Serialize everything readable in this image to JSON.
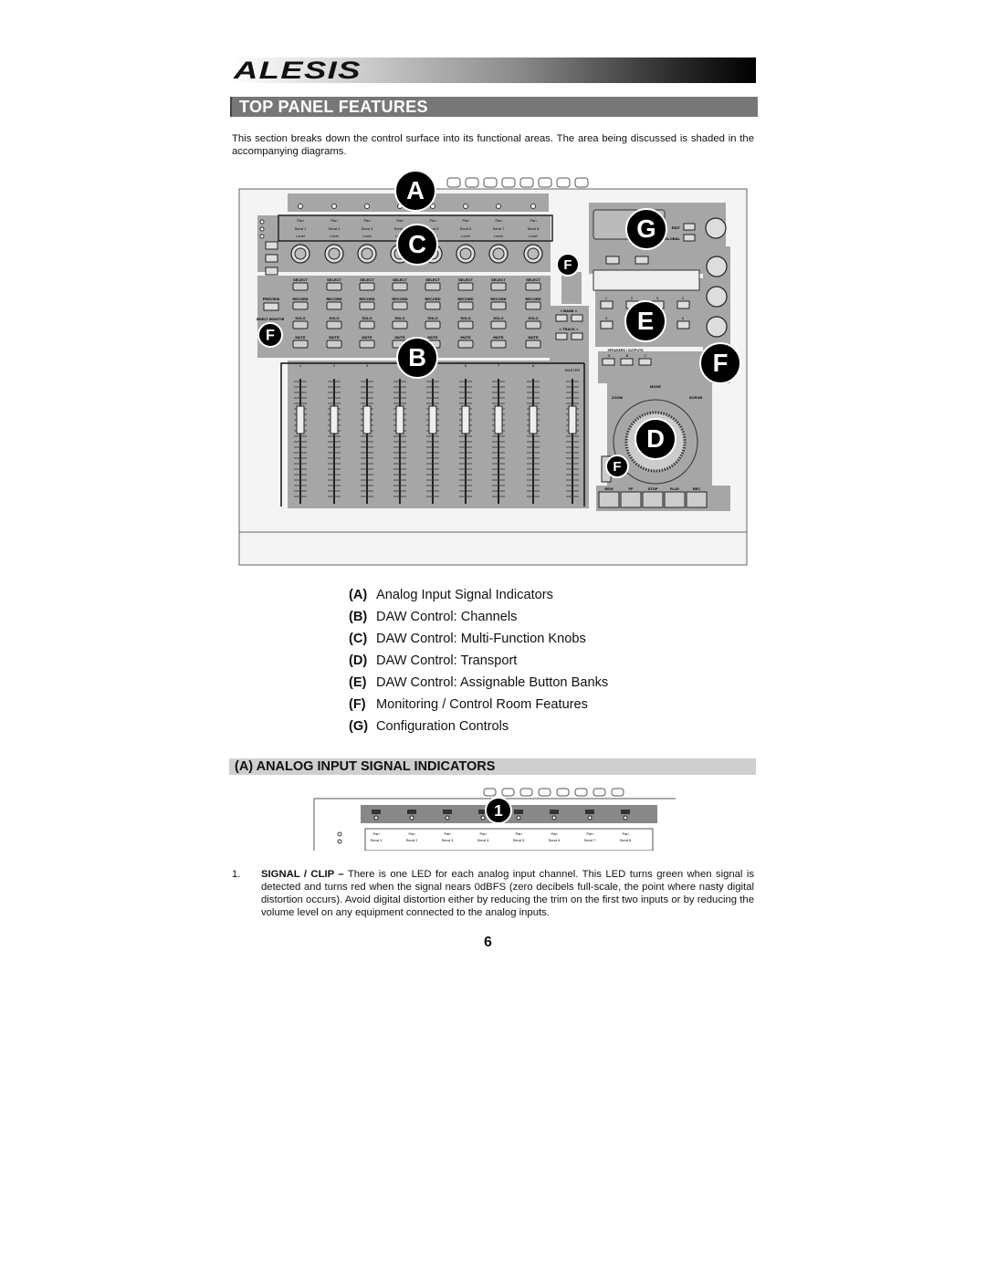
{
  "header": {
    "brand": "ALESIS",
    "title": "TOP PANEL FEATURES"
  },
  "intro": "This section breaks down the control surface into its functional areas.  The area being discussed is shaded in the accompanying diagrams.",
  "diagram": {
    "callouts": [
      "A",
      "B",
      "C",
      "D",
      "E",
      "F",
      "G"
    ],
    "channel_buttons": [
      "SELECT",
      "RECORD",
      "SOLO",
      "MUTE"
    ],
    "knob_labels": [
      "Pan",
      "Send",
      "Level"
    ],
    "left_buttons": [
      "PREVIEW",
      "DIRECT MONITOR"
    ],
    "nav": [
      "BANK",
      "TRACK"
    ],
    "master": "MASTER",
    "transport": [
      "REW",
      "FF",
      "STOP",
      "PLAY",
      "REC"
    ],
    "wheel": {
      "mode": "MODE",
      "left": "ZOOM",
      "right": "SCRUB"
    },
    "speakers": {
      "label": "SPEAKERS / OUTPUTS",
      "buttons": [
        "A",
        "B",
        "C"
      ]
    },
    "config": [
      "EDIT",
      "GLOBAL"
    ],
    "bank_buttons": [
      "1",
      "2",
      "3",
      "4",
      "5",
      "6"
    ],
    "shade_color": "#a6a6a6"
  },
  "legend": [
    {
      "key": "(A)",
      "text": "Analog Input Signal Indicators"
    },
    {
      "key": "(B)",
      "text": "DAW Control: Channels"
    },
    {
      "key": "(C)",
      "text": "DAW Control: Multi-Function Knobs"
    },
    {
      "key": "(D)",
      "text": "DAW Control: Transport"
    },
    {
      "key": "(E)",
      "text": "DAW Control: Assignable Button Banks"
    },
    {
      "key": "(F)",
      "text": "Monitoring / Control Room Features"
    },
    {
      "key": "(G)",
      "text": "Configuration Controls"
    }
  ],
  "section": {
    "title": "(A) ANALOG INPUT SIGNAL INDICATORS",
    "callout": "1",
    "items": [
      {
        "num": "1.",
        "term": "SIGNAL / CLIP –",
        "text": " There is one LED for each analog input channel.  This LED turns green when signal is detected and turns red when the signal nears 0dBFS (zero decibels full-scale, the point where nasty digital distortion occurs).  Avoid digital distortion either by reducing the trim on the first two inputs or by reducing the volume level on any equipment connected to the analog inputs."
      }
    ]
  },
  "page_number": "6"
}
